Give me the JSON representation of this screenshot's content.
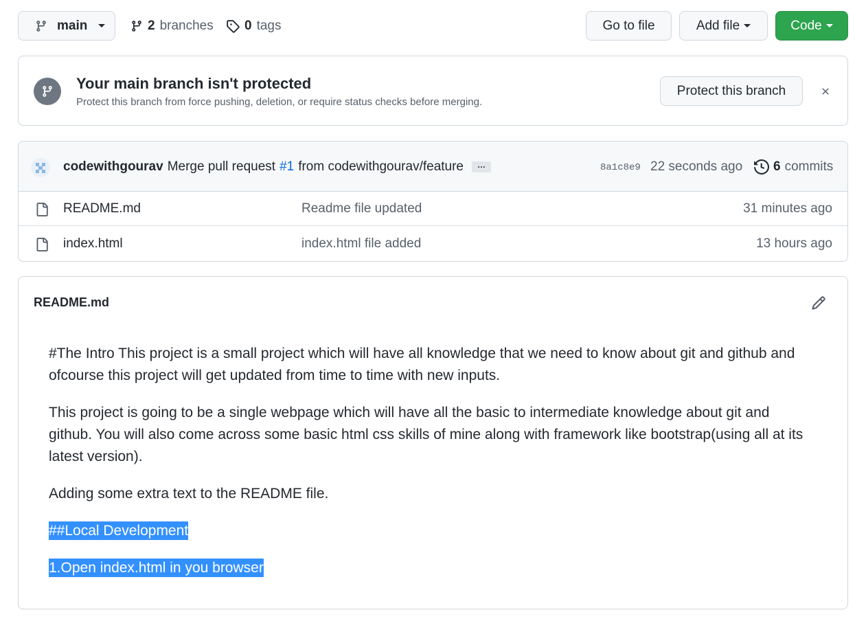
{
  "toolbar": {
    "branch": "main",
    "branches_count": "2",
    "branches_label": "branches",
    "tags_count": "0",
    "tags_label": "tags",
    "go_to_file": "Go to file",
    "add_file": "Add file",
    "code": "Code"
  },
  "banner": {
    "title": "Your main branch isn't protected",
    "subtitle": "Protect this branch from force pushing, deletion, or require status checks before merging.",
    "protect_button": "Protect this branch"
  },
  "latest_commit": {
    "author": "codewithgourav",
    "message_prefix": "Merge pull request",
    "pr_ref": "#1",
    "message_suffix": "from codewithgourav/feature",
    "ellipsis": "…",
    "sha": "8a1c8e9",
    "time": "22 seconds ago",
    "commits_count": "6",
    "commits_label": "commits"
  },
  "files": [
    {
      "name": "README.md",
      "message": "Readme file updated",
      "age": "31 minutes ago"
    },
    {
      "name": "index.html",
      "message": "index.html file added",
      "age": "13 hours ago"
    }
  ],
  "readme": {
    "title": "README.md",
    "paragraphs": [
      "#The Intro This project is a small project which will have all knowledge that we need to know about git and github and ofcourse this project will get updated from time to time with new inputs.",
      "This project is going to be a single webpage which will have all the basic to intermediate knowledge about git and github. You will also come across some basic html css skills of mine along with framework like bootstrap(using all at its latest version).",
      "Adding some extra text to the README file."
    ],
    "highlighted": [
      "##Local Development ",
      "1.Open index.html in you browser"
    ]
  },
  "colors": {
    "code_button": "#2da44e",
    "link": "#0969da",
    "selection": "#3390ff"
  },
  "icons": {
    "branch": "git-branch-icon",
    "tag": "tag-icon",
    "close": "close-icon",
    "history": "history-icon",
    "file": "file-icon",
    "edit": "pencil-icon"
  }
}
